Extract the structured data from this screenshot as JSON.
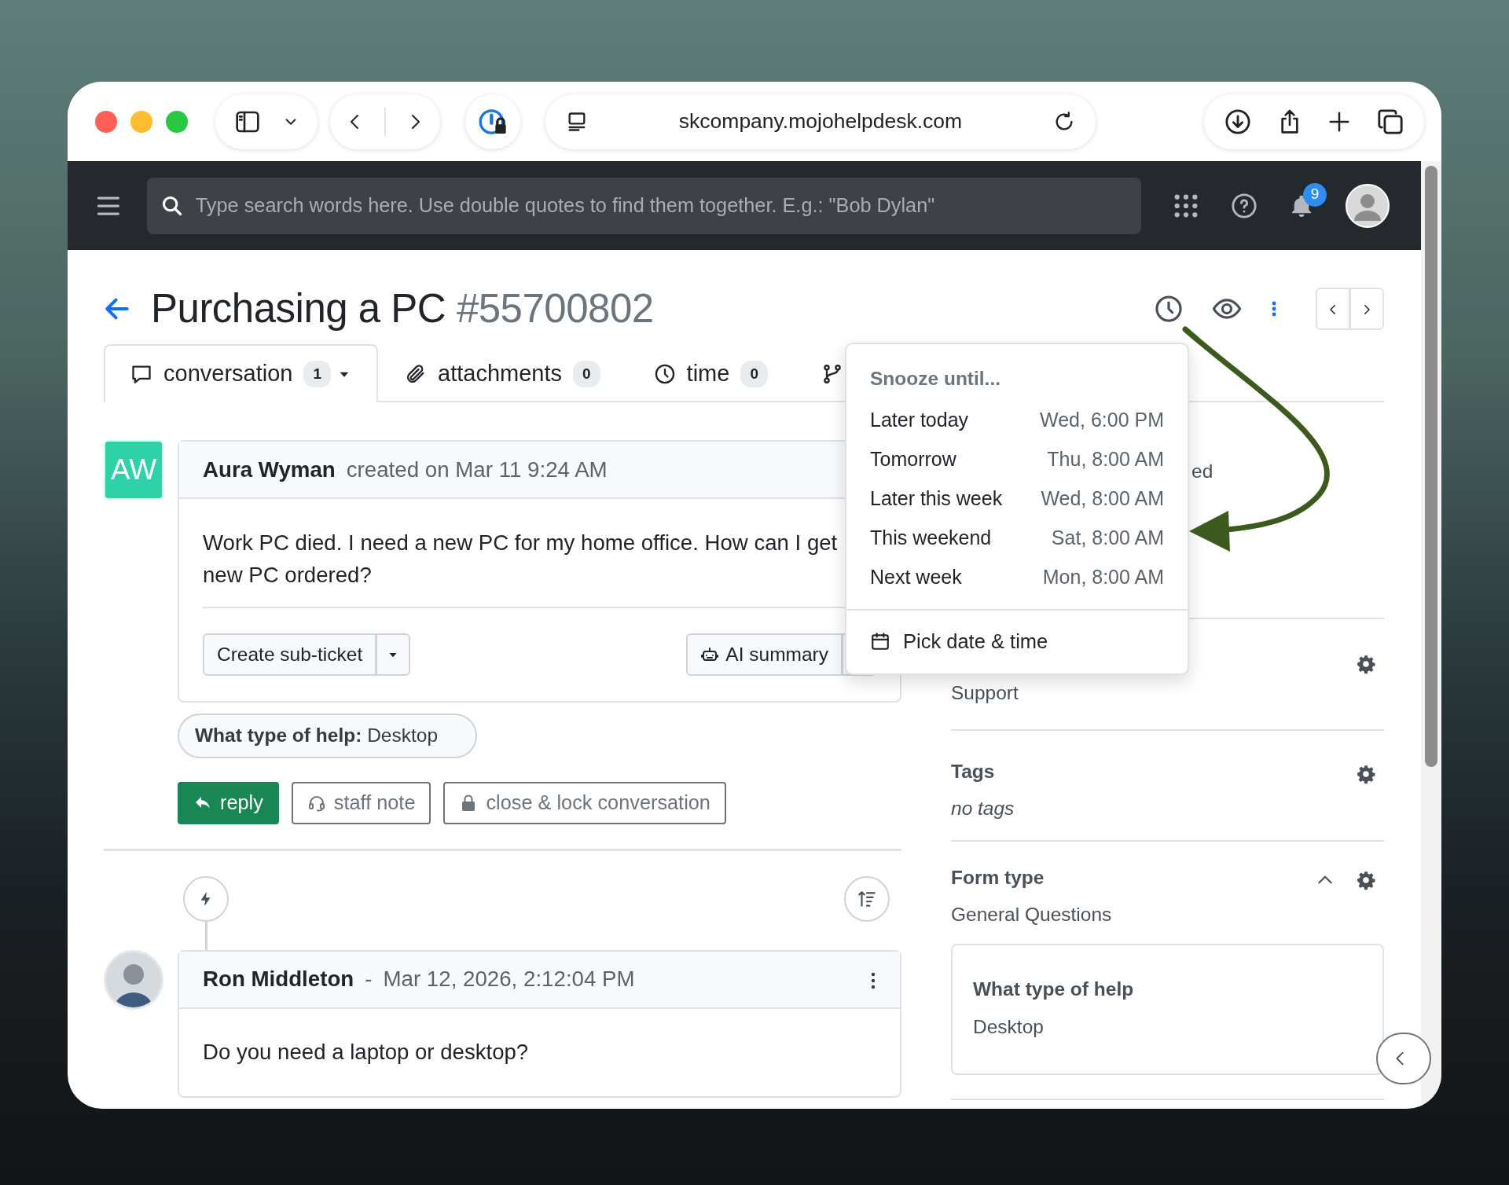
{
  "browser": {
    "url": "skcompany.mojohelpdesk.com"
  },
  "topbar": {
    "search_placeholder": "Type search words here. Use double quotes to find them together. E.g.: \"Bob Dylan\"",
    "notification_count": "9"
  },
  "ticket": {
    "title": "Purchasing a PC",
    "number": "#55700802"
  },
  "tabs": [
    {
      "kind": "comment",
      "label": "conversation",
      "count": "1",
      "has_menu": true,
      "selected": true
    },
    {
      "kind": "paperclip",
      "label": "attachments",
      "count": "0",
      "has_menu": false,
      "selected": false
    },
    {
      "kind": "clock",
      "label": "time",
      "count": "0",
      "has_menu": false,
      "selected": false
    },
    {
      "kind": "branch",
      "has_menu": false,
      "selected": false
    }
  ],
  "message": {
    "author": "Aura Wyman",
    "initials": "AW",
    "meta": "created on Mar 11 9:24 AM",
    "body_lines": [
      "Work PC died. I need a new PC for my home office. How can I get",
      "new PC ordered?"
    ],
    "split_buttons": [
      {
        "kind": "plain",
        "label": "Create sub-ticket"
      },
      {
        "kind": "robot",
        "label": "AI summary"
      }
    ],
    "tag": "**What type of help:** Desktop",
    "actions": [
      {
        "kind": "reply",
        "label": "reply"
      },
      {
        "kind": "note",
        "label": "staff note"
      },
      {
        "kind": "lock",
        "label": "close & lock conversation"
      }
    ]
  },
  "replies": [
    {
      "author": "Ron Middleton",
      "separator": "-",
      "date": "Mar 12, 2026, 2:12:04 PM",
      "body": "Do you need a laptop or desktop?"
    }
  ],
  "sidebar": [
    {
      "value": "ed",
      "has_settings": false
    },
    {
      "value": "Support",
      "has_settings": true
    },
    {
      "label": "Tags",
      "value": "no tags",
      "empty": true,
      "has_settings": true
    },
    {
      "label": "Form type",
      "value": "General Questions",
      "empty": false,
      "has_settings": true,
      "expanded": true,
      "fields": [
        {
          "label": "What type of help",
          "value": "Desktop"
        }
      ]
    }
  ],
  "snooze_menu": {
    "title": "Snooze until...",
    "options": [
      {
        "label": "Later today",
        "time": "Wed, 6:00 PM"
      },
      {
        "label": "Tomorrow",
        "time": "Thu, 8:00 AM"
      },
      {
        "label": "Later this week",
        "time": "Wed, 8:00 AM"
      },
      {
        "label": "This weekend",
        "time": "Sat, 8:00 AM"
      },
      {
        "label": "Next week",
        "time": "Mon, 8:00 AM"
      }
    ],
    "custom": "Pick date & time"
  }
}
